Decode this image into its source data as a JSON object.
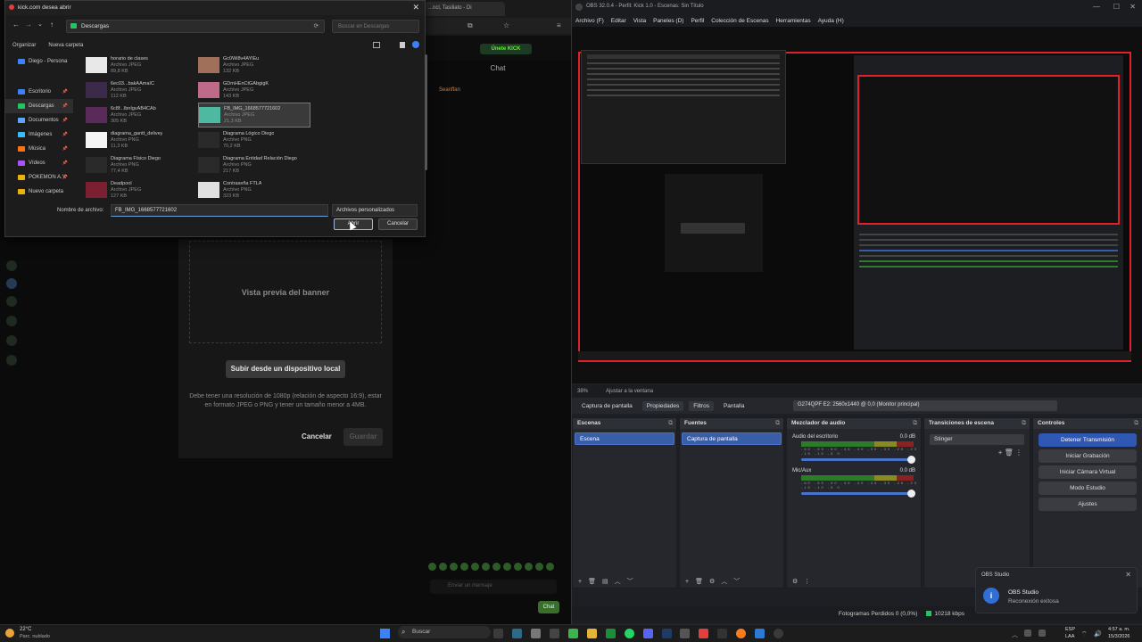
{
  "browser": {
    "tab_title": "...ncl, Tasiliato - Di",
    "subscribe_label": "Únete KICK",
    "chat_title": "Chat",
    "chat_user": "Seanffan"
  },
  "modal": {
    "banner_preview": "Vista previa del banner",
    "upload_button": "Subir desde un dispositivo local",
    "hint": "Debe tener una resolución de 1080p (relación de aspecto 16:9), estar en formato JPEG o PNG y tener un tamaño menor a 4MB.",
    "cancel": "Cancelar",
    "save": "Guardar"
  },
  "chat": {
    "input_placeholder": "Enviar un mensaje",
    "send": "Chat"
  },
  "dialog": {
    "title": "kick.com desea abrir",
    "path": "Descargas",
    "search_placeholder": "Buscar en Descargas",
    "organize": "Organizar",
    "new_folder": "Nueva carpeta",
    "sidebar": [
      {
        "label": "Diego - Persona",
        "color": "#3b82f6"
      },
      {
        "label": "Escritorio",
        "color": "#3b82f6"
      },
      {
        "label": "Descargas",
        "color": "#22c55e"
      },
      {
        "label": "Documentos",
        "color": "#60a5fa"
      },
      {
        "label": "Imágenes",
        "color": "#38bdf8"
      },
      {
        "label": "Música",
        "color": "#f97316"
      },
      {
        "label": "Vídeos",
        "color": "#a855f7"
      },
      {
        "label": "POKEMON A.Y.",
        "color": "#eab308"
      },
      {
        "label": "Nuevo carpeta",
        "color": "#eab308"
      }
    ],
    "files_left": [
      {
        "name": "horario de clases",
        "type": "Archivo JPEG",
        "size": "89,8 KB",
        "thumb": "#e8e8e8"
      },
      {
        "name": "6ec03...bakAAmaIC",
        "type": "Archivo JPEG",
        "size": "112 KB",
        "thumb": "#3b2a4a"
      },
      {
        "name": "6c8f...lbnIgvAB4CAb",
        "type": "Archivo JPEG",
        "size": "305 KB",
        "thumb": "#5a2a5a"
      },
      {
        "name": "diagrama_gantt_delivey",
        "type": "Archivo PNG",
        "size": "11,3 KB",
        "thumb": "#f4f4f4"
      },
      {
        "name": "Diagrama Físico Diego",
        "type": "Archivo PNG",
        "size": "77,4 KB",
        "thumb": "#2a2a2a"
      },
      {
        "name": "Deadpool",
        "type": "Archivo JPEG",
        "size": "127 KB",
        "thumb": "#7a2030"
      }
    ],
    "files_right": [
      {
        "name": "Gc0Wi8v4AYlEu",
        "type": "Archivo JPEG",
        "size": "132 KB",
        "thumb": "#a0705a"
      },
      {
        "name": "GDmHEnCtGAbgigK",
        "type": "Archivo JPEG",
        "size": "143 KB",
        "thumb": "#c06a8a"
      },
      {
        "name": "FB_IMG_1668577721602",
        "type": "Archivo JPEG",
        "size": "21,3 KB",
        "thumb": "#4fb8a0"
      },
      {
        "name": "Diagrama Lógico Diego",
        "type": "Archivo PNG",
        "size": "70,2 KB",
        "thumb": "#2a2a2a"
      },
      {
        "name": "Diagrama Entidad Relación Diego",
        "type": "Archivo PNG",
        "size": "217 KB",
        "thumb": "#2a2a2a"
      },
      {
        "name": "Contraseña FTLA",
        "type": "Archivo PNG",
        "size": "323 KB",
        "thumb": "#e0e0e0"
      }
    ],
    "filename_label": "Nombre de archivo:",
    "filename_value": "FB_IMG_1668577721602",
    "filetype": "Archivos personalizados",
    "open": "Abrir",
    "cancel": "Cancelar"
  },
  "obs": {
    "title": "OBS 32.0.4 - Perfil: Kick 1.0 - Escenas: Sin Título",
    "menu": [
      "Archivo (F)",
      "Editar",
      "Vista",
      "Paneles (D)",
      "Perfil",
      "Colección de Escenas",
      "Herramientas",
      "Ayuda (H)"
    ],
    "zoom": "38%",
    "zoom_to_window": "Ajustar a la ventana",
    "source_name": "Captura de pantalla",
    "properties": "Propiedades",
    "filters": "Filtros",
    "display_label": "Pantalla",
    "display_value": "G274QPF E2: 2560x1440 @ 0,0 (Monitor principal)",
    "docks": {
      "scenes": {
        "title": "Escenas",
        "selected": "Escena"
      },
      "sources": {
        "title": "Fuentes",
        "selected": "Captura de pantalla"
      },
      "mixer": {
        "title": "Mezclador de audio",
        "channels": [
          {
            "name": "Audio del escritorio",
            "db": "0.0 dB"
          },
          {
            "name": "Mic/Aux",
            "db": "0.0 dB"
          }
        ],
        "scale": "-60 -55 -50 -45 -40 -35 -30 -25 -20 -15 -10 -5 0"
      },
      "transitions": {
        "title": "Transiciones de escena",
        "value": "Stinger"
      },
      "controls": {
        "title": "Controles",
        "buttons": [
          "Detener Transmisión",
          "Iniciar Grabación",
          "Iniciar Cámara Virtual",
          "Modo Estudio",
          "Ajustes"
        ]
      }
    },
    "status": {
      "dropped": "Fotogramas Perdidos 0 (0,0%)",
      "bitrate": "10218 kbps"
    },
    "toast": {
      "app": "OBS Studio",
      "title": "OBS Studio",
      "message": "Reconexión exitosa"
    }
  },
  "taskbar": {
    "weather_temp": "22°C",
    "weather_desc": "Parc. nublado",
    "search": "Buscar",
    "lang": "ESP",
    "lang2": "LAA",
    "time": "4:57 a. m.",
    "date": "15/3/2026"
  }
}
